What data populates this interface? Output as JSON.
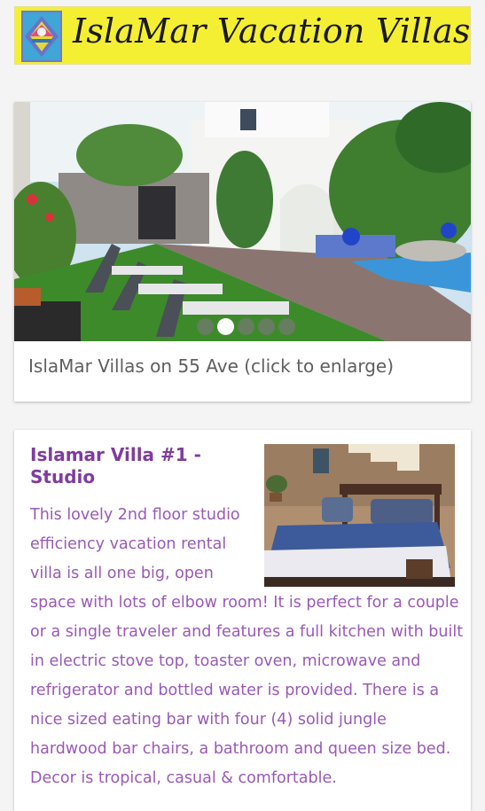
{
  "header": {
    "title": "IslaMar Vacation Villas",
    "logo_icon": "islamar-logo-icon",
    "bg_color": "#f5ef34"
  },
  "slider": {
    "caption": "IslaMar Villas on 55 Ave (click to enlarge)",
    "dot_count": 5,
    "active_dot": 2
  },
  "villa": {
    "title": "Islamar Villa #1 - Studio",
    "title_color": "#7f3c9e",
    "text_color": "#9a59b7",
    "description_lines": [
      "This lovely 2nd floor studio",
      "efficiency vacation rental",
      "villa is all one big, open",
      "space with lots of elbow room! It is perfect for a couple",
      "or a single traveler and features a full kitchen with built",
      "in electric stove top, toaster oven, microwave and",
      "refrigerator and bottled water is provided. There is a",
      "nice sized eating bar with four (4) solid jungle",
      "hardwood bar chairs, a bathroom and queen size bed.",
      "Decor is tropical, casual & comfortable."
    ]
  }
}
